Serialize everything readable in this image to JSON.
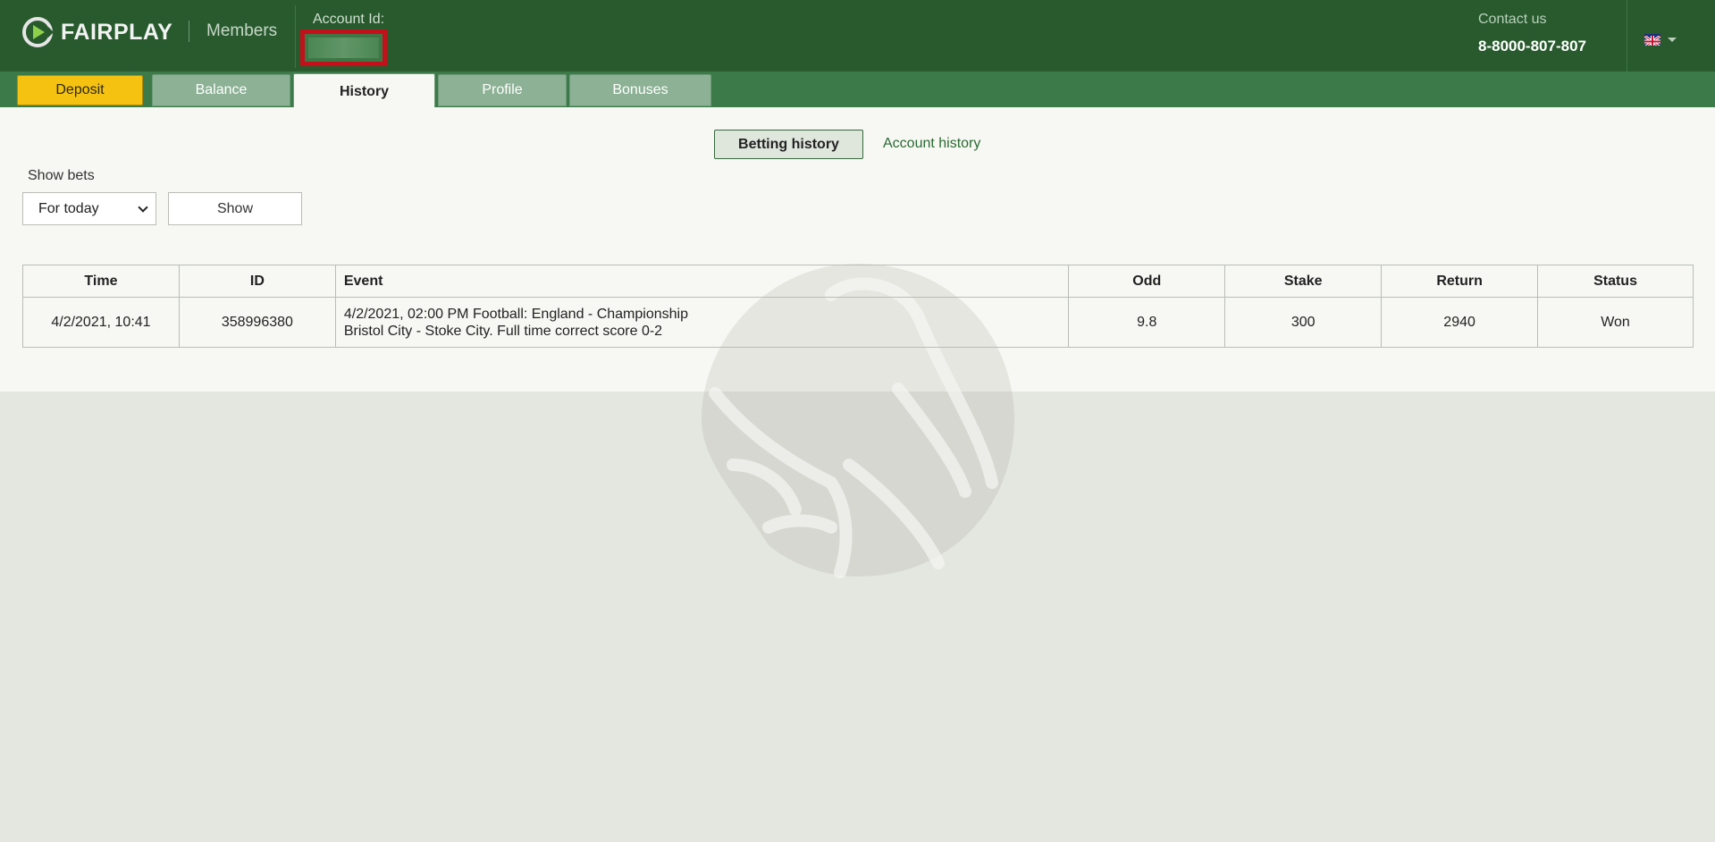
{
  "brand": {
    "name": "FAIRPLAY",
    "section": "Members"
  },
  "account": {
    "label": "Account Id:",
    "value_redacted": true
  },
  "contact": {
    "label": "Contact us",
    "phone": "8-8000-807-807"
  },
  "language": {
    "icon": "uk-flag-icon"
  },
  "tabs": [
    {
      "label": "Deposit",
      "style": "accent"
    },
    {
      "label": "Balance"
    },
    {
      "label": "History",
      "active": true
    },
    {
      "label": "Profile"
    },
    {
      "label": "Bonuses"
    }
  ],
  "history": {
    "subtabs": {
      "active": "Betting history",
      "other": "Account history"
    },
    "filter": {
      "label": "Show bets",
      "selected": "For today",
      "button": "Show"
    }
  },
  "table": {
    "columns": [
      "Time",
      "ID",
      "Event",
      "Odd",
      "Stake",
      "Return",
      "Status"
    ],
    "rows": [
      {
        "time": "4/2/2021, 10:41",
        "id": "358996380",
        "event_line1": "4/2/2021, 02:00 PM Football: England - Championship",
        "event_line2": "Bristol City - Stoke City. Full time correct score 0-2",
        "odd": "9.8",
        "stake": "300",
        "return": "2940",
        "status": "Won"
      }
    ]
  },
  "colors": {
    "header_bg": "#285a2e",
    "tabbar_bg": "#3d7a4a",
    "deposit_accent": "#f5c211",
    "status_won": "#1e64c8",
    "redaction_border": "#c3101a"
  }
}
